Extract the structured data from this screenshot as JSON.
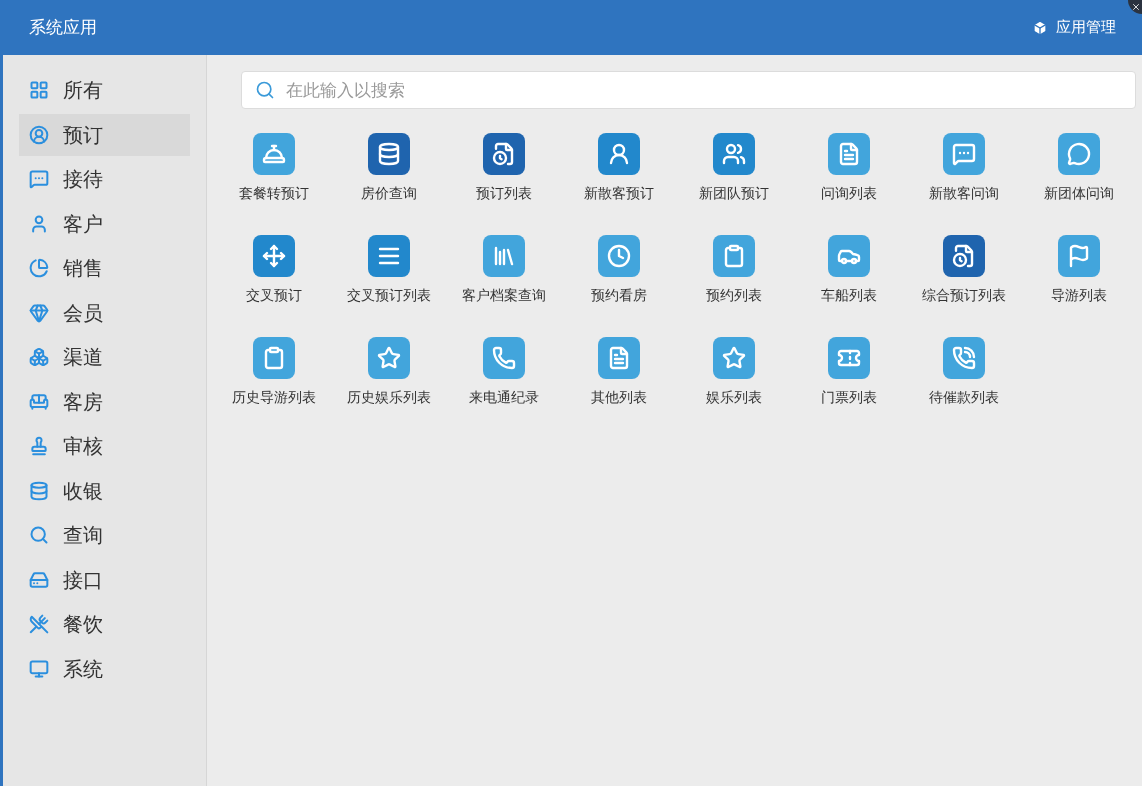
{
  "window": {
    "title": "系统应用",
    "manage_label": "应用管理"
  },
  "sidebar": {
    "items": [
      {
        "label": "所有",
        "selected": false
      },
      {
        "label": "预订",
        "selected": true
      },
      {
        "label": "接待",
        "selected": false
      },
      {
        "label": "客户",
        "selected": false
      },
      {
        "label": "销售",
        "selected": false
      },
      {
        "label": "会员",
        "selected": false
      },
      {
        "label": "渠道",
        "selected": false
      },
      {
        "label": "客房",
        "selected": false
      },
      {
        "label": "审核",
        "selected": false
      },
      {
        "label": "收银",
        "selected": false
      },
      {
        "label": "查询",
        "selected": false
      },
      {
        "label": "接口",
        "selected": false
      },
      {
        "label": "餐饮",
        "selected": false
      },
      {
        "label": "系统",
        "selected": false
      }
    ]
  },
  "search": {
    "placeholder": "在此输入以搜索"
  },
  "apps": [
    {
      "label": "套餐转预订",
      "color": "#42a5dc"
    },
    {
      "label": "房价查询",
      "color": "#1f64ae"
    },
    {
      "label": "预订列表",
      "color": "#1f64ae"
    },
    {
      "label": "新散客预订",
      "color": "#2288cc"
    },
    {
      "label": "新团队预订",
      "color": "#2288cc"
    },
    {
      "label": "问询列表",
      "color": "#42a5dc"
    },
    {
      "label": "新散客问询",
      "color": "#42a5dc"
    },
    {
      "label": "新团体问询",
      "color": "#42a5dc"
    },
    {
      "label": "交叉预订",
      "color": "#2288cc"
    },
    {
      "label": "交叉预订列表",
      "color": "#2288cc"
    },
    {
      "label": "客户档案查询",
      "color": "#42a5dc"
    },
    {
      "label": "预约看房",
      "color": "#42a5dc"
    },
    {
      "label": "预约列表",
      "color": "#42a5dc"
    },
    {
      "label": "车船列表",
      "color": "#42a5dc"
    },
    {
      "label": "综合预订列表",
      "color": "#1f64ae"
    },
    {
      "label": "导游列表",
      "color": "#42a5dc"
    },
    {
      "label": "历史导游列表",
      "color": "#42a5dc"
    },
    {
      "label": "历史娱乐列表",
      "color": "#42a5dc"
    },
    {
      "label": "来电通纪录",
      "color": "#42a5dc"
    },
    {
      "label": "其他列表",
      "color": "#42a5dc"
    },
    {
      "label": "娱乐列表",
      "color": "#42a5dc"
    },
    {
      "label": "门票列表",
      "color": "#42a5dc"
    },
    {
      "label": "待催款列表",
      "color": "#42a5dc"
    }
  ]
}
